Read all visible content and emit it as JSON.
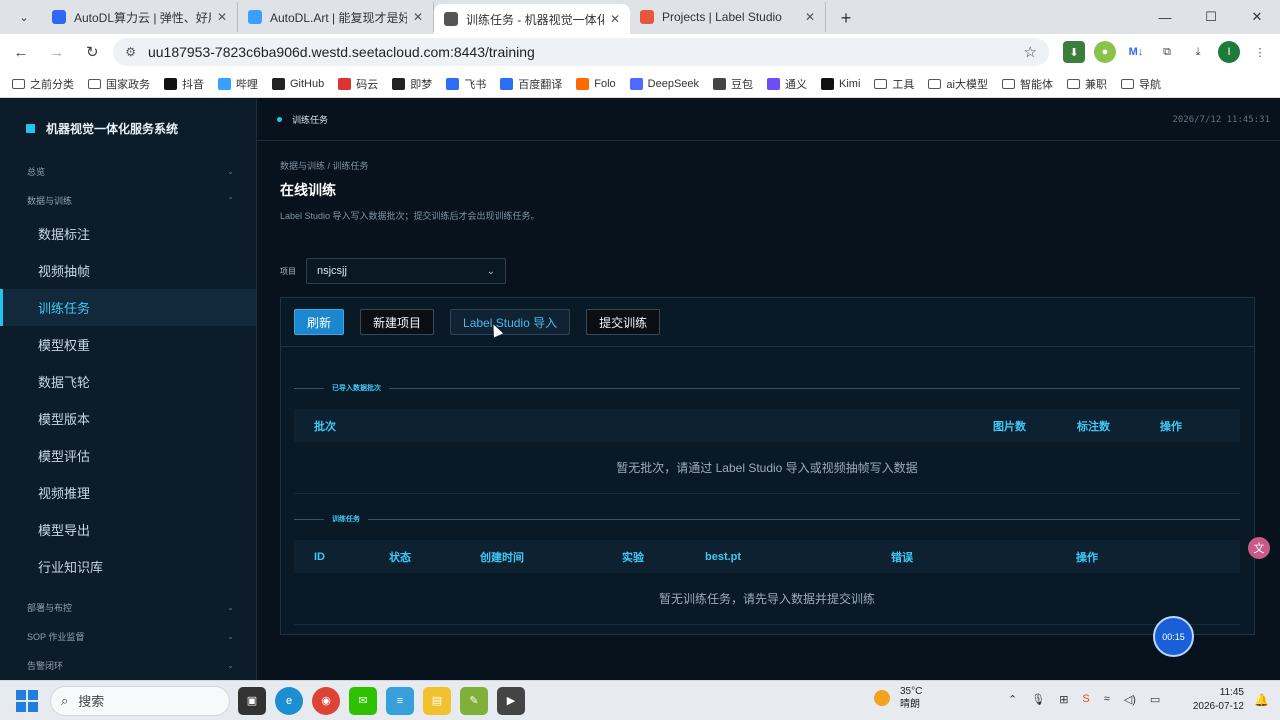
{
  "browser": {
    "tabs": [
      {
        "title": "AutoDL算力云 | 弹性、好用、",
        "fav_color": "#2f67f6",
        "active": false
      },
      {
        "title": "AutoDL.Art | 能复现才是好算法",
        "fav_color": "#3aa0ff",
        "active": false
      },
      {
        "title": "训练任务 - 机器视觉一体化服务系",
        "fav_color": "#555555",
        "active": true
      },
      {
        "title": "Projects | Label Studio",
        "fav_color": "#e8573c",
        "active": false
      }
    ],
    "url": "uu187953-7823c6ba906d.westd.seetacloud.com:8443/training",
    "bookmarks": [
      "之前分类",
      "国家政务",
      "抖音",
      "哔哩",
      "GitHub",
      "码云",
      "即梦",
      "飞书",
      "百度翻译",
      "Folo",
      "DeepSeek",
      "豆包",
      "通义",
      "Kimi",
      "工具",
      "ai大模型",
      "智能体",
      "兼职",
      "导航"
    ]
  },
  "app": {
    "brand": "机器视觉一体化服务系统",
    "header": {
      "crumb": "训练任务",
      "clock": "2026/7/12 11:45:31"
    },
    "sidebar": {
      "groups_top": [
        {
          "label": "总览"
        },
        {
          "label": "数据与训练"
        }
      ],
      "items": [
        {
          "label": "数据标注"
        },
        {
          "label": "视频抽帧"
        },
        {
          "label": "训练任务"
        },
        {
          "label": "模型权重"
        },
        {
          "label": "数据飞轮"
        },
        {
          "label": "模型版本"
        },
        {
          "label": "模型评估"
        },
        {
          "label": "视频推理"
        },
        {
          "label": "模型导出"
        },
        {
          "label": "行业知识库"
        }
      ],
      "active_index": 2,
      "groups_bottom": [
        {
          "label": "部署与布控"
        },
        {
          "label": "SOP 作业监督"
        },
        {
          "label": "告警闭环"
        }
      ]
    },
    "page": {
      "breadcrumb": "数据与训练 / 训练任务",
      "title": "在线训练",
      "subtitle": "Label Studio 导入写入数据批次；提交训练后才会出现训练任务。",
      "project_label": "项目",
      "project_value": "nsjcsjj"
    },
    "toolbar": {
      "refresh": "刷新",
      "new_project": "新建项目",
      "ls_import": "Label Studio 导入",
      "submit": "提交训练"
    },
    "batches": {
      "section_title": "已导入数据批次",
      "columns": [
        "批次",
        "图片数",
        "标注数",
        "操作"
      ],
      "empty": "暂无批次，请通过 Label Studio 导入或视频抽帧写入数据"
    },
    "jobs": {
      "section_title": "训练任务",
      "columns": [
        "ID",
        "状态",
        "创建时间",
        "实验",
        "best.pt",
        "错误",
        "操作"
      ],
      "empty": "暂无训练任务，请先导入数据并提交训练"
    },
    "timer": "00:15"
  },
  "taskbar": {
    "search_placeholder": "搜索",
    "weather_temp": "35°C",
    "weather_desc": "晴朗",
    "time": "11:45",
    "date": "2026-07-12"
  }
}
